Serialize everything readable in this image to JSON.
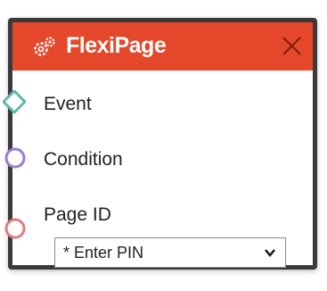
{
  "node": {
    "title": "FlexiPage",
    "header_color": "#e5472a",
    "icon": "gear-cluster-icon",
    "close_icon": "close-icon"
  },
  "ports": {
    "event": {
      "label": "Event",
      "color": "#5fb8a4",
      "shape": "diamond"
    },
    "condition": {
      "label": "Condition",
      "color": "#9a7fd0",
      "shape": "circle"
    },
    "page_id": {
      "label": "Page ID",
      "color": "#e07b82",
      "shape": "circle"
    }
  },
  "page_id_select": {
    "selected": "* Enter PIN"
  }
}
